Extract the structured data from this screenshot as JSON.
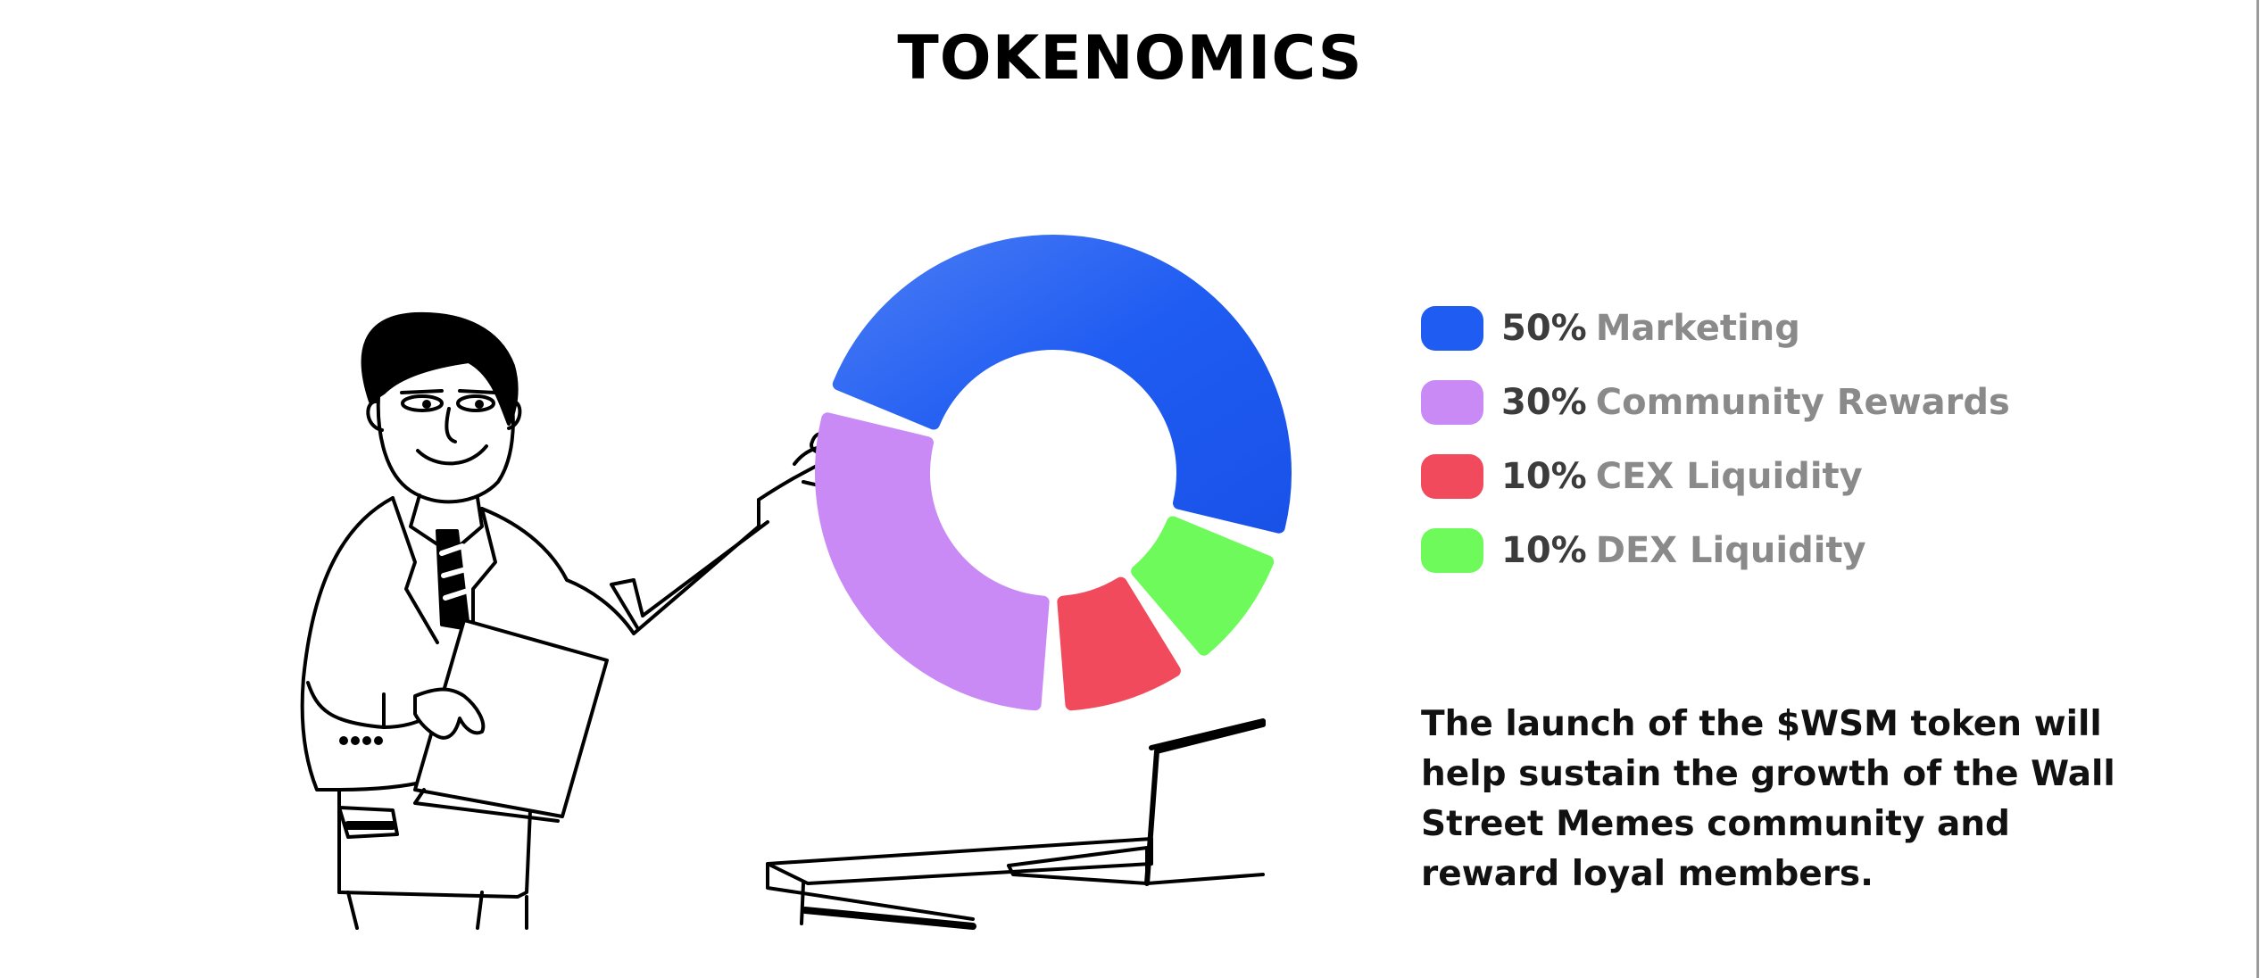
{
  "title": "TOKENOMICS",
  "description": "The launch of the $WSM token will help sustain the growth of the Wall Street Memes community and reward loyal members.",
  "chart_data": {
    "type": "pie",
    "categories": [
      "Marketing",
      "Community Rewards",
      "CEX Liquidity",
      "DEX Liquidity"
    ],
    "values": [
      50,
      30,
      10,
      10
    ],
    "value_labels": [
      "50%",
      "30%",
      "10%",
      "10%"
    ],
    "colors": [
      "#1f5cf2",
      "#c98af5",
      "#f04a5c",
      "#6efa5a"
    ],
    "style": "donut",
    "legend": "right"
  },
  "illustration": {
    "icons": [
      "presenter-figure-icon",
      "laptop-desk-icon"
    ]
  }
}
